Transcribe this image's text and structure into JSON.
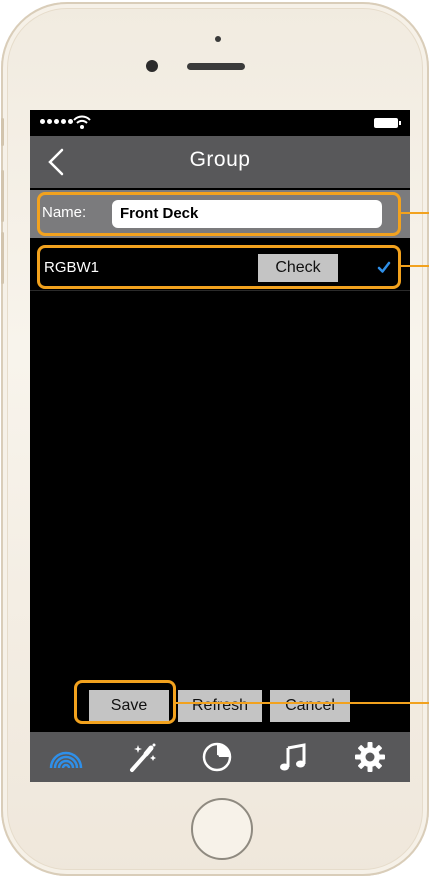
{
  "status_bar": {
    "signal_dots": 5,
    "wifi_icon": "wifi-icon",
    "battery_icon": "battery-icon"
  },
  "nav": {
    "title": "Group",
    "back_icon": "chevron-left-icon"
  },
  "name_field": {
    "label": "Name:",
    "value": "Front Deck"
  },
  "devices": [
    {
      "name": "RGBW1",
      "check_label": "Check",
      "selected": true
    }
  ],
  "actions": {
    "save_label": "Save",
    "refresh_label": "Refresh",
    "cancel_label": "Cancel"
  },
  "tabs": [
    {
      "icon": "rainbow-icon",
      "active": true
    },
    {
      "icon": "magic-wand-icon",
      "active": false
    },
    {
      "icon": "timer-icon",
      "active": false
    },
    {
      "icon": "music-note-icon",
      "active": false
    },
    {
      "icon": "gear-icon",
      "active": false
    }
  ],
  "colors": {
    "accent_blue": "#2f8fe8",
    "callout_orange": "#f2a21e",
    "bar_gray": "#58585a",
    "button_gray": "#c4c4c4"
  }
}
